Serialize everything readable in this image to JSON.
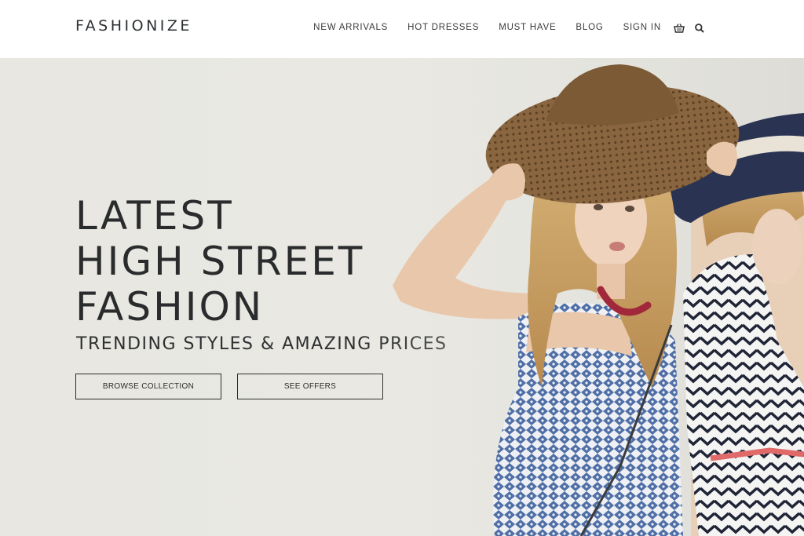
{
  "brand": {
    "logo_text": "FASHIONIZE"
  },
  "nav": {
    "items": [
      "NEW ARRIVALS",
      "HOT DRESSES",
      "MUST HAVE",
      "BLOG",
      "SIGN IN"
    ],
    "icons": [
      "basket-icon",
      "search-icon"
    ]
  },
  "hero": {
    "title_lines": [
      "LATEST",
      "HIGH STREET",
      "FASHION"
    ],
    "subtitle": "TRENDING STYLES & AMAZING PRICES",
    "buttons": {
      "browse": "BROWSE COLLECTION",
      "offers": "SEE OFFERS"
    }
  },
  "colors": {
    "header_bg": "#ffffff",
    "hero_bg": "#e9e8e2",
    "text": "#2b2b2b"
  }
}
